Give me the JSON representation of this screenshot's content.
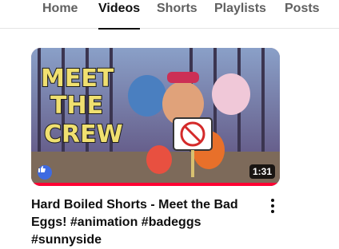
{
  "tabs": [
    {
      "label": "Home",
      "active": false
    },
    {
      "label": "Videos",
      "active": true
    },
    {
      "label": "Shorts",
      "active": false
    },
    {
      "label": "Playlists",
      "active": false
    },
    {
      "label": "Posts",
      "active": false
    }
  ],
  "video": {
    "title": "Hard Boiled Shorts - Meet the Bad Eggs! #animation #badeggs #sunnyside",
    "duration": "1:31",
    "thumbnail_text": [
      "MEET",
      "THE",
      "CREW"
    ],
    "watch_progress": 1.0,
    "progress_color": "#ff0033",
    "badge_icon": "thumbs-up-icon",
    "more_icon": "more-vert-icon"
  }
}
